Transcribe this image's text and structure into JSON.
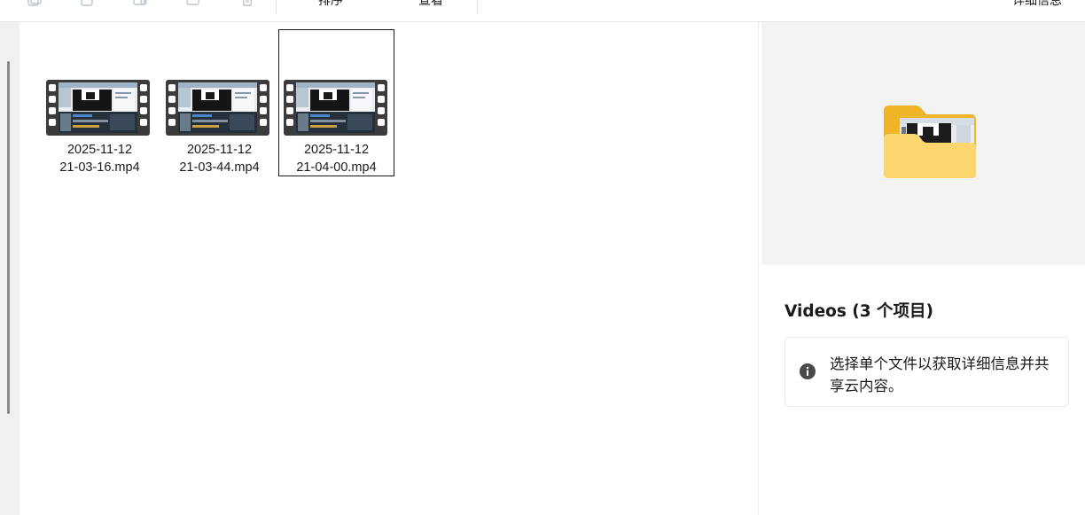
{
  "toolbar": {
    "sort_label": "排序",
    "view_label": "查看",
    "details_label": "详细信息"
  },
  "files": [
    {
      "name_line1": "2025-11-12",
      "name_line2": "21-03-16.mp4",
      "selected": false
    },
    {
      "name_line1": "2025-11-12",
      "name_line2": "21-03-44.mp4",
      "selected": false
    },
    {
      "name_line1": "2025-11-12",
      "name_line2": "21-04-00.mp4",
      "selected": true
    }
  ],
  "details": {
    "title": "Videos (3 个项目)",
    "info_message": "选择单个文件以获取详细信息并共享云内容。",
    "preview_icon": "folder-icon"
  },
  "colors": {
    "accent": "#0067c0",
    "folder_back": "#f0b428",
    "folder_front": "#fbd66d",
    "selection_border": "#1a1a1a",
    "preview_bg": "#f3f3f3"
  }
}
